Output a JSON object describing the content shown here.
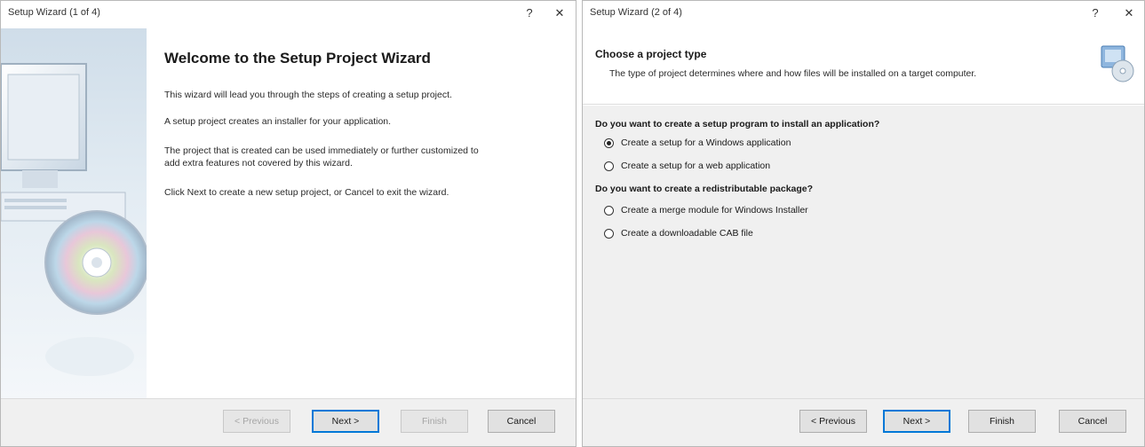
{
  "wizard1": {
    "title": "Setup Wizard (1 of 4)",
    "help_label": "?",
    "close_label": "✕",
    "heading": "Welcome to the Setup Project Wizard",
    "paragraphs": [
      "This wizard will lead you through the steps of creating a setup project.",
      "A setup project creates an installer for your application.",
      "The project that is created can be used immediately or further customized to",
      "add extra features not covered by this wizard.",
      "Click Next to create a new setup project, or Cancel to exit the wizard."
    ],
    "buttons": {
      "previous": "< Previous",
      "next": "Next >",
      "finish": "Finish",
      "cancel": "Cancel"
    }
  },
  "wizard2": {
    "title": "Setup Wizard (2 of 4)",
    "help_label": "?",
    "close_label": "✕",
    "header_title": "Choose a project type",
    "header_subtitle": "The type of project determines where and how files will be installed on a target computer.",
    "question1": "Do you want to create a setup program to install an application?",
    "options1": [
      {
        "label": "Create a setup for a Windows application",
        "checked": true
      },
      {
        "label": "Create a setup for a web application",
        "checked": false
      }
    ],
    "question2": "Do you want to create a redistributable package?",
    "options2": [
      {
        "label": "Create a merge module for Windows Installer",
        "checked": false
      },
      {
        "label": "Create a downloadable CAB file",
        "checked": false
      }
    ],
    "buttons": {
      "previous": "< Previous",
      "next": "Next >",
      "finish": "Finish",
      "cancel": "Cancel"
    }
  },
  "colors": {
    "accent": "#0078d7",
    "footer_bg": "#f0f0f0",
    "side_panel": "#cfdde9"
  },
  "icons": [
    "help-icon",
    "close-icon",
    "computer-cd-art",
    "setup-project-icon"
  ]
}
